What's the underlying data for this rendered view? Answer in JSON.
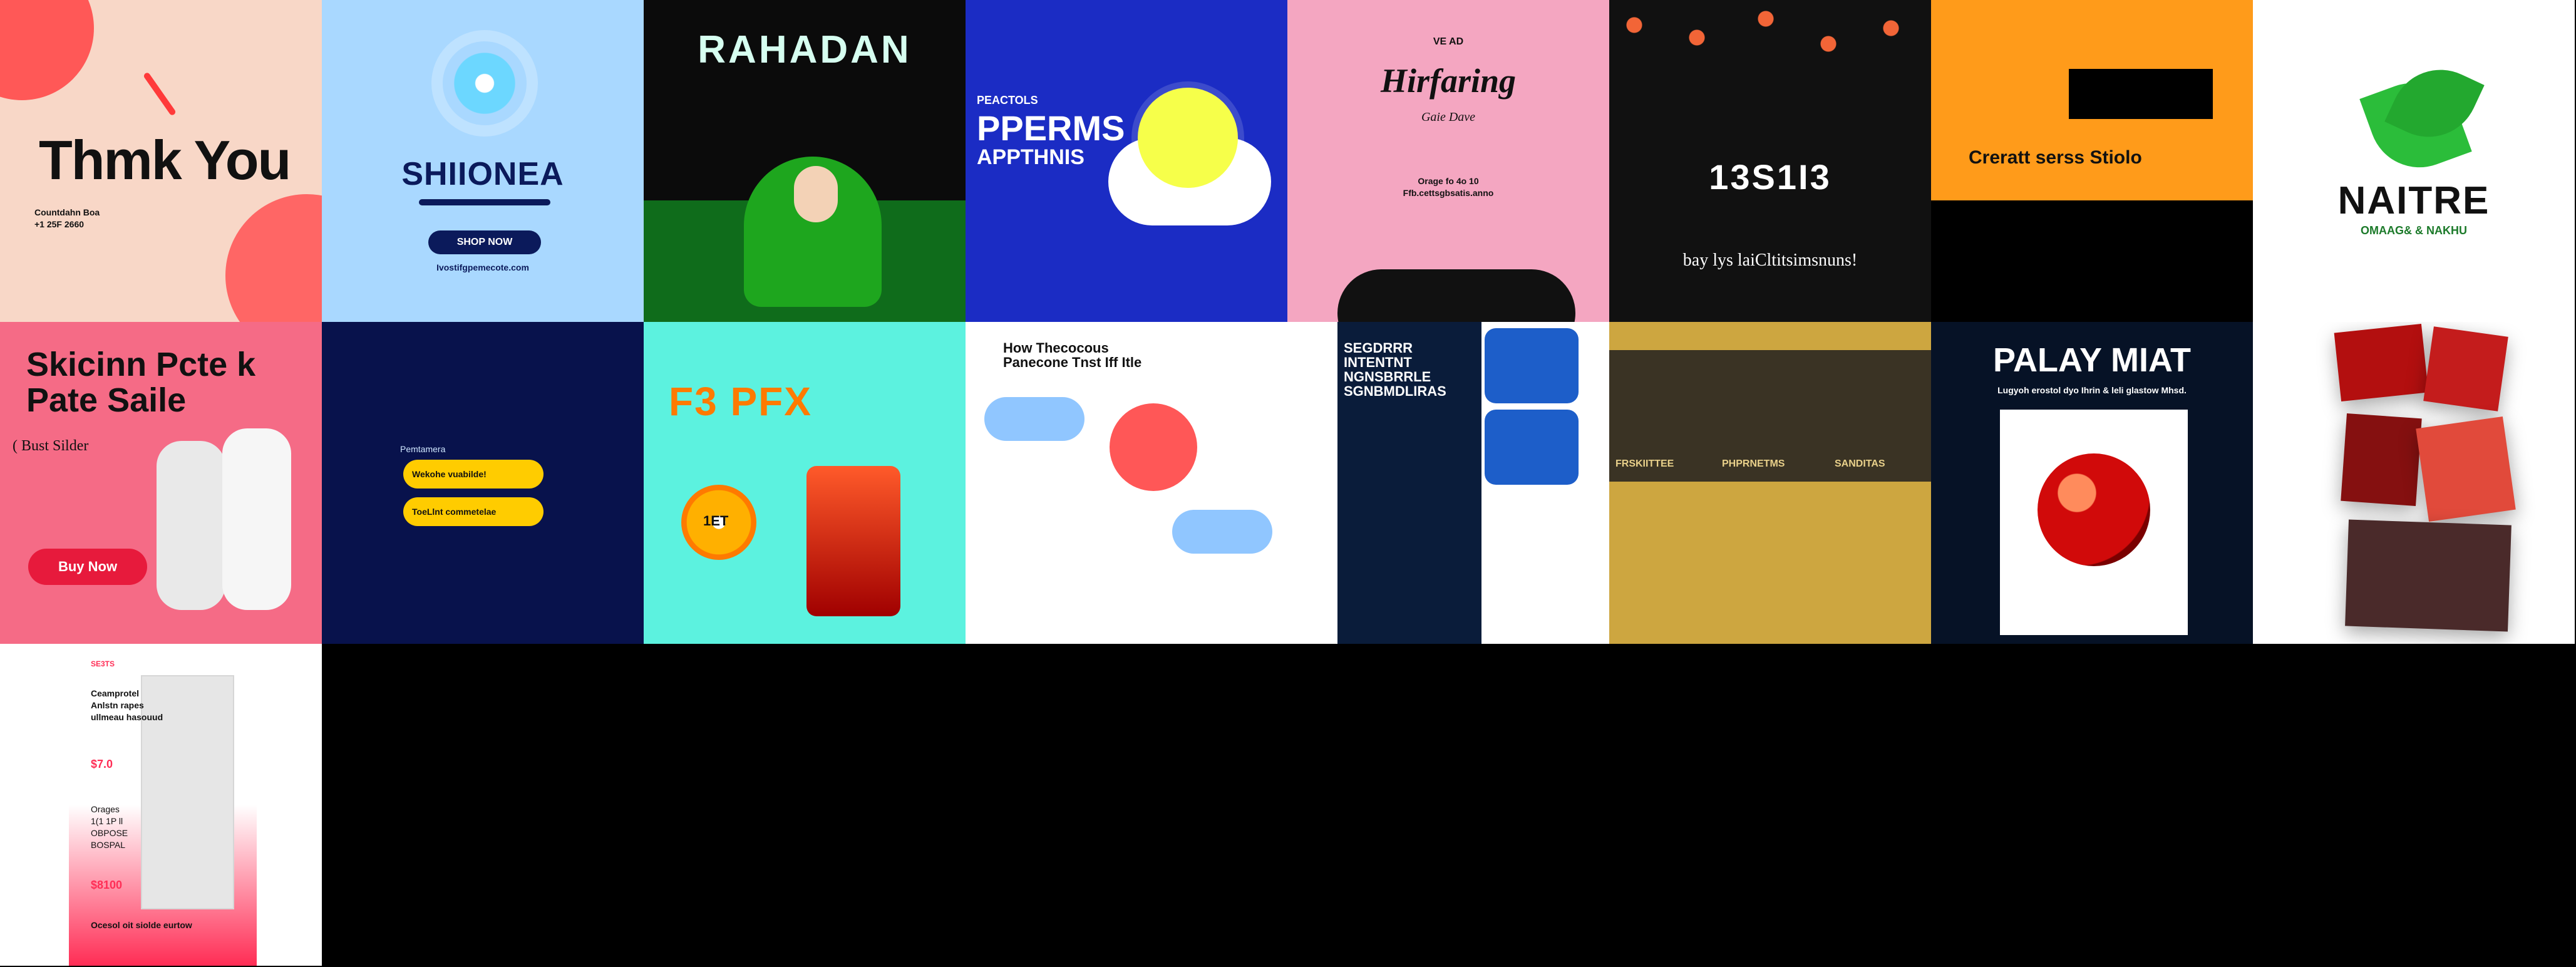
{
  "grid": {
    "tile_colors": {
      "t1": "#f8d7c7",
      "t2": "#a9d8ff",
      "t3": "#0b0b0b",
      "t4": "#1b2cc4",
      "t5": "#f4a6c1",
      "t6": "#111111",
      "t7": "#ff9b1a",
      "t8": "#ffffff",
      "t9": "#f56b86",
      "t10": "#08124c",
      "t11": "#5cf2df",
      "t12": "#ffffff",
      "t13": "#ffffff",
      "t14": "#cda640",
      "t15": "#061226",
      "t16": "#ffffff",
      "t17": "#ffffff"
    },
    "tiles": [
      {
        "id": "thank-you",
        "title": "Thmk You",
        "subtitle": "Countdahn Boa\n+1 25F 2660"
      },
      {
        "id": "shionea",
        "title": "SHIIONEA",
        "cta": "SHOP NOW",
        "footer": "Ivostifgpemecote.com"
      },
      {
        "id": "ramadan",
        "title": "RAHADAN"
      },
      {
        "id": "pperms",
        "kicker": "PEACTOLS",
        "title": "PPERMS",
        "subtitle": "APPTHNIS"
      },
      {
        "id": "hirearing",
        "top": "VE AD",
        "title": "Hirfaring",
        "subtitle": "Gaie Dave",
        "contact": "Orage fo 4o 10\nFfb.cettsgbsatis.anno"
      },
      {
        "id": "lights",
        "number": "13S1I3",
        "line": "bay  lys laiCltitsimsnuns!"
      },
      {
        "id": "studio",
        "title": "Creratt serss Stiolo"
      },
      {
        "id": "nature",
        "title": "NAITRE",
        "subtitle": "OMAAG& & NAKHU"
      },
      {
        "id": "skincare",
        "title": "Skicinn Pcte k\nPate Saile",
        "subtitle": "( Bust Silder",
        "cta": "Buy Now"
      },
      {
        "id": "chat",
        "header": "Pemtamera",
        "msg1": "Wekohe vuabilde!",
        "msg2": "ToeLlnt commetelae"
      },
      {
        "id": "fruit",
        "title": "F3 PFX",
        "price": "1ET"
      },
      {
        "id": "infographic",
        "title": "How Thecocous\nPanecone Tnst Iff Itle"
      },
      {
        "id": "business",
        "title": "SEGDRRR\nINTENTNT\nNGNSBRRLE\nSGNBMDLIRAS"
      },
      {
        "id": "gold-brochure",
        "labels": [
          "FRSKIITTEE",
          "PHPRNETMS",
          "SANDITAS"
        ]
      },
      {
        "id": "palay",
        "title": "PALAY MIAT",
        "subtitle": "Lugyoh erostol dyo Ihrin & leli glastow Mhsd."
      },
      {
        "id": "photos",
        "title": ""
      },
      {
        "id": "fashion",
        "tag": "SE3TS",
        "headline": "Ceamprotel\nAnlstn rapes\nullmeau hasouud",
        "price1": "$7.0",
        "note": "Orages\n1(1 1P ll\nOBPOSE\nBOSPAL",
        "price2": "$8100",
        "foot": "Ocesol oit siolde eurtow"
      }
    ]
  }
}
